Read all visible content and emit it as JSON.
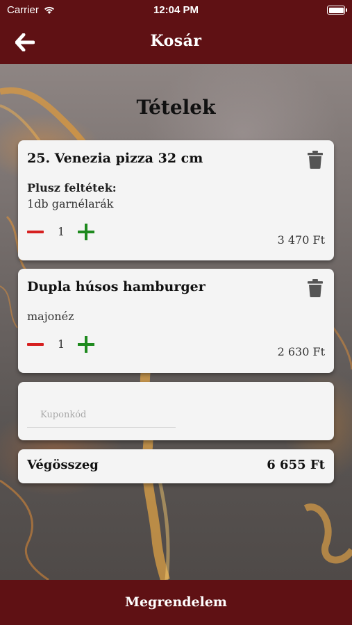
{
  "status_bar": {
    "carrier": "Carrier",
    "time": "12:04 PM"
  },
  "nav": {
    "title": "Kosár"
  },
  "heading": "Tételek",
  "items": [
    {
      "name": "25. Venezia pizza 32 cm",
      "extras_label": "Plusz feltétek:",
      "extras": "1db garnélarák",
      "quantity": "1",
      "price": "3 470 Ft"
    },
    {
      "name": "Dupla húsos hamburger",
      "extras": "majonéz",
      "quantity": "1",
      "price": "2 630 Ft"
    }
  ],
  "coupon": {
    "placeholder": "Kuponkód"
  },
  "total": {
    "label": "Végösszeg",
    "value": "6 655 Ft"
  },
  "order_button": "Megrendelem",
  "colors": {
    "brand": "#5f1114",
    "minus": "#d62020",
    "plus": "#1e8a1e",
    "lava": "#ffa834"
  }
}
